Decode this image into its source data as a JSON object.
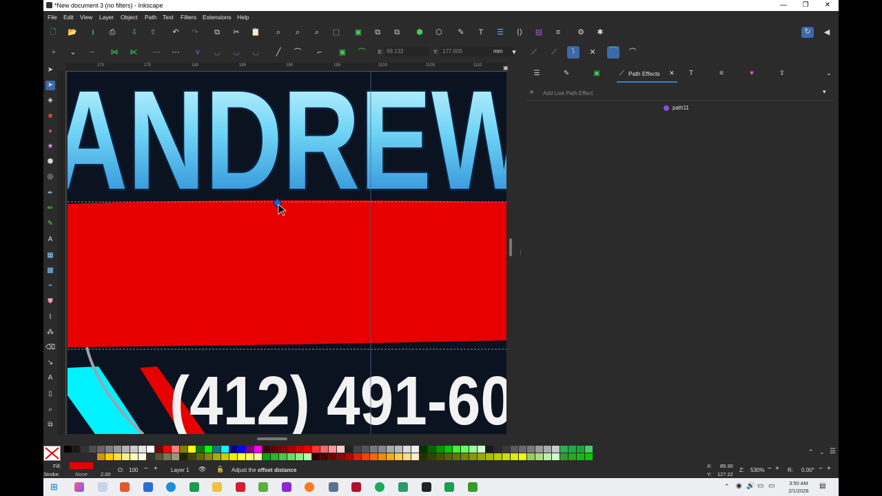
{
  "window": {
    "title": "*New document 3 (no filters) - Inkscape",
    "controls": [
      "—",
      "❐",
      "✕"
    ]
  },
  "menu": [
    "File",
    "Edit",
    "View",
    "Layer",
    "Object",
    "Path",
    "Text",
    "Filters",
    "Extensions",
    "Help"
  ],
  "toolbar": {
    "x_label": "X:",
    "x_value": "99.133",
    "y_label": "Y:",
    "y_value": "177.605",
    "unit": "mm"
  },
  "ruler": {
    "h_ticks": [
      "170",
      "175",
      "180",
      "185",
      "190",
      "195",
      "1100",
      "1105",
      "1110"
    ],
    "v_ticks": [
      "35",
      "120",
      "125",
      "130",
      "135",
      "140",
      "145",
      "150",
      "155",
      "160"
    ]
  },
  "canvas": {
    "headline": "ANDREW",
    "phone": "(412) 491-60",
    "colors": {
      "banner": "#e60000",
      "bg": "#0d1420",
      "text_top": "#cdf5ff",
      "text_bottom": "#1e88d4",
      "cyan": "#00f7ff"
    }
  },
  "dock": {
    "active_tab": "Path Effects",
    "search_placeholder": "Add Live Path Effect",
    "item": "path11"
  },
  "status": {
    "fill_label": "Fill:",
    "fill_color": "#e60000",
    "stroke_label": "Stroke:",
    "stroke_value": "None",
    "stroke_width": "2.00",
    "opacity_label": "O:",
    "opacity_value": "100",
    "layer": "Layer 1",
    "message_prefix": "Adjust the ",
    "message_bold": "offset distance",
    "cursor_x_label": "X:",
    "cursor_x": "89.30",
    "cursor_y_label": "Y:",
    "cursor_y": "127.22",
    "zoom_label": "Z:",
    "zoom": "530%",
    "rotate_label": "R:",
    "rotate": "0.00°"
  },
  "taskbar": {
    "time": "3:50 AM",
    "date": "2/1/2026"
  }
}
